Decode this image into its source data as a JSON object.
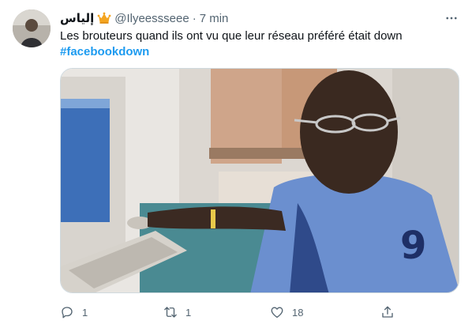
{
  "tweet": {
    "display_name": "إلياس",
    "verified_badge_icon": "crown-emoji-icon",
    "handle": "@Ilyeessseee",
    "separator": "·",
    "timestamp": "7 min",
    "text": "Les brouteurs quand ils ont vu que leur réseau préféré était down",
    "hashtag": "#facebookdown"
  },
  "actions": {
    "reply_count": "1",
    "retweet_count": "1",
    "like_count": "18"
  },
  "colors": {
    "link": "#1d9bf0",
    "secondary_text": "#536471",
    "primary_text": "#0f1419"
  }
}
